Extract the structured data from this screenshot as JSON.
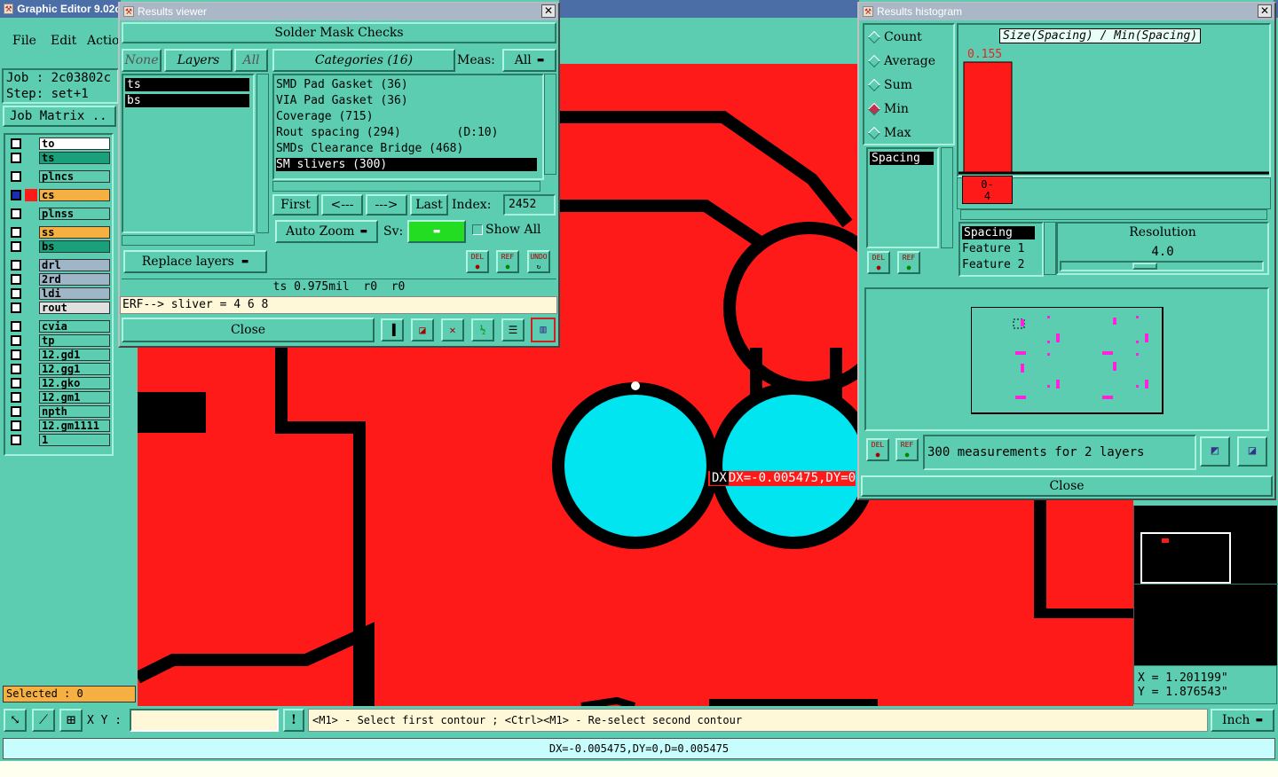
{
  "main": {
    "title": "Graphic Editor 9.02c",
    "menu": [
      "File",
      "Edit",
      "Actio"
    ],
    "job_label": "Job : 2c03802c",
    "step_label": "Step: set+1",
    "job_matrix": "Job Matrix ..",
    "layers": [
      {
        "name": "to",
        "color": "#ffffff"
      },
      {
        "name": "ts",
        "color": "#1aa07a"
      },
      {
        "name": "plncs",
        "color": "#5ccdb1"
      },
      {
        "name": "cs",
        "color": "#f5b041"
      },
      {
        "name": "plnss",
        "color": "#5ccdb1"
      },
      {
        "name": "ss",
        "color": "#f5b041"
      },
      {
        "name": "bs",
        "color": "#1aa07a"
      },
      {
        "name": "drl",
        "color": "#9fb5c8"
      },
      {
        "name": "2rd",
        "color": "#9fb5c8"
      },
      {
        "name": "ldi",
        "color": "#9fb5c8"
      },
      {
        "name": "rout",
        "color": "#e0e0e0"
      },
      {
        "name": "cvia",
        "color": "#5ccdb1"
      },
      {
        "name": "tp",
        "color": "#5ccdb1"
      },
      {
        "name": "12.gd1",
        "color": "#5ccdb1"
      },
      {
        "name": "12.gg1",
        "color": "#5ccdb1"
      },
      {
        "name": "12.gko",
        "color": "#5ccdb1"
      },
      {
        "name": "12.gm1",
        "color": "#5ccdb1"
      },
      {
        "name": "npth",
        "color": "#5ccdb1"
      },
      {
        "name": "12.gm1111",
        "color": "#5ccdb1"
      },
      {
        "name": "1",
        "color": "#5ccdb1"
      }
    ],
    "selected": "Selected : 0",
    "xy_label": "X Y :",
    "xy_value": "",
    "prompt": "<M1> - Select first contour ; <Ctrl><M1> - Re-select second contour",
    "units": "Inch",
    "status": "DX=-0.005475,DY=0,D=0.005475",
    "measure_overlay": "DX=-0.005475,DY=0,D",
    "coord_x": "X = 1.201199\"",
    "coord_y": "Y = 1.876543\""
  },
  "results_viewer": {
    "title": "Results viewer",
    "header": "Solder Mask Checks",
    "none_btn": "None",
    "layers_btn": "Layers",
    "all_btn": "All",
    "layer_list": [
      "ts",
      "bs"
    ],
    "categories_btn": "Categories (16)",
    "meas_label": "Meas:",
    "meas_value": "All",
    "categories": [
      "SMD Pad Gasket (36)",
      "VIA Pad Gasket (36)",
      "Coverage (715)",
      "Rout spacing (294)        (D:10)",
      "SMDs Clearance Bridge (468)",
      "SM slivers (300)"
    ],
    "first_btn": "First",
    "prev_btn": "<---",
    "next_btn": "--->",
    "last_btn": "Last",
    "index_label": "Index:",
    "index_value": "2452",
    "auto_zoom": "Auto Zoom",
    "sv_label": "Sv:",
    "show_all": "Show All",
    "replace_layers": "Replace layers",
    "del_btn": "DEL",
    "ref_btn": "REF",
    "undo_btn": "UNDO",
    "info_line": "ts 0.975mil  r0  r0",
    "erf_line": "ERF--> sliver = 4 6 8",
    "close_btn": "Close"
  },
  "histogram": {
    "title": "Results histogram",
    "radios": [
      "Count",
      "Average",
      "Sum",
      "Min",
      "Max"
    ],
    "selected_radio": "Min",
    "graph_title": "Size(Spacing) / Min(Spacing)",
    "bar_value": "0.155",
    "bar_label_top": "0-",
    "bar_label_bottom": "4",
    "spacing_list": [
      "Spacing"
    ],
    "attr_list": [
      "Spacing",
      "Feature 1",
      "Feature 2"
    ],
    "resolution_label": "Resolution",
    "resolution_value": "4.0",
    "measurements": "300 measurements for 2 layers",
    "close_btn": "Close",
    "del_btn": "DEL",
    "ref_btn": "REF"
  },
  "chart_data": {
    "type": "bar",
    "title": "Size(Spacing) / Min(Spacing)",
    "categories": [
      "0-4"
    ],
    "values": [
      0.155
    ]
  }
}
